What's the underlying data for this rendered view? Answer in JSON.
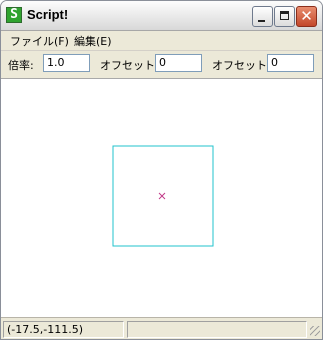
{
  "window": {
    "title": "Script!",
    "app_icon_glyph": "S"
  },
  "menu": {
    "file": "ファイル(F)",
    "edit": "編集(E)"
  },
  "toolbar": {
    "scale_label": "倍率:",
    "scale_value": "1.0",
    "offset_x_label": "オフセットX:",
    "offset_x_value": "0",
    "offset_y_label": "オフセットY:",
    "offset_y_value": "0"
  },
  "canvas": {
    "square_color": "#22c3cc",
    "marker_color": "#c23a8a"
  },
  "status": {
    "coords": "(-17.5,-111.5)",
    "pane2": ""
  }
}
